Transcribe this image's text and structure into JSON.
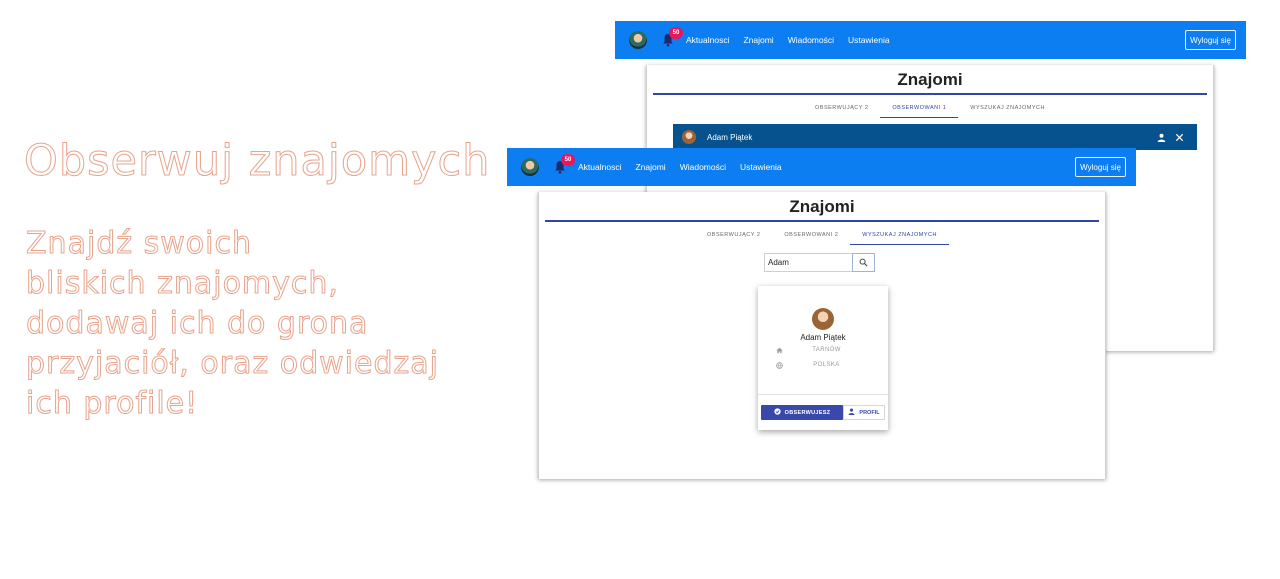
{
  "promo": {
    "title": "Obserwuj znajomych",
    "lines": [
      "Znajdź swoich",
      "bliskich znajomych,",
      "dodawaj ich do grona",
      "przyjaciół, oraz odwiedzaj",
      "ich profile!"
    ]
  },
  "navbar": {
    "notification_count": "50",
    "links": [
      "Aktualnosci",
      "Znajomi",
      "Wiadomości",
      "Ustawienia"
    ],
    "logout_label": "Wyloguj się",
    "color": "#0d7ef2"
  },
  "back_screen": {
    "page_title": "Znajomi",
    "tabs": [
      "OBSERWUJĄCY 2",
      "OBSERWOWANI 1",
      "WYSZUKAJ ZNAJOMYCH"
    ],
    "active_tab": "OBSERWOWANI 1",
    "profile_bar": {
      "name": "Adam Piątek",
      "icons": [
        "person-icon",
        "close-icon"
      ]
    }
  },
  "front_screen": {
    "page_title": "Znajomi",
    "tabs": [
      "OBSERWUJĄCY 2",
      "OBSERWOWANI 2",
      "WYSZUKAJ ZNAJOMYCH"
    ],
    "active_tab": "WYSZUKAJ ZNAJOMYCH",
    "search": {
      "value": "Adam",
      "icon": "search-icon"
    },
    "result": {
      "name": "Adam Piątek",
      "city": "TARNÓW",
      "country": "POLSKA",
      "follow_label": "OBSERWUJESZ",
      "profile_label": "PROFIL"
    }
  },
  "colors": {
    "accent": "#3949ab",
    "title_rule": "#2f46ad",
    "profile_bar": "#06528e",
    "badge": "#e8175d",
    "promo_outline": "#e8a38b"
  }
}
